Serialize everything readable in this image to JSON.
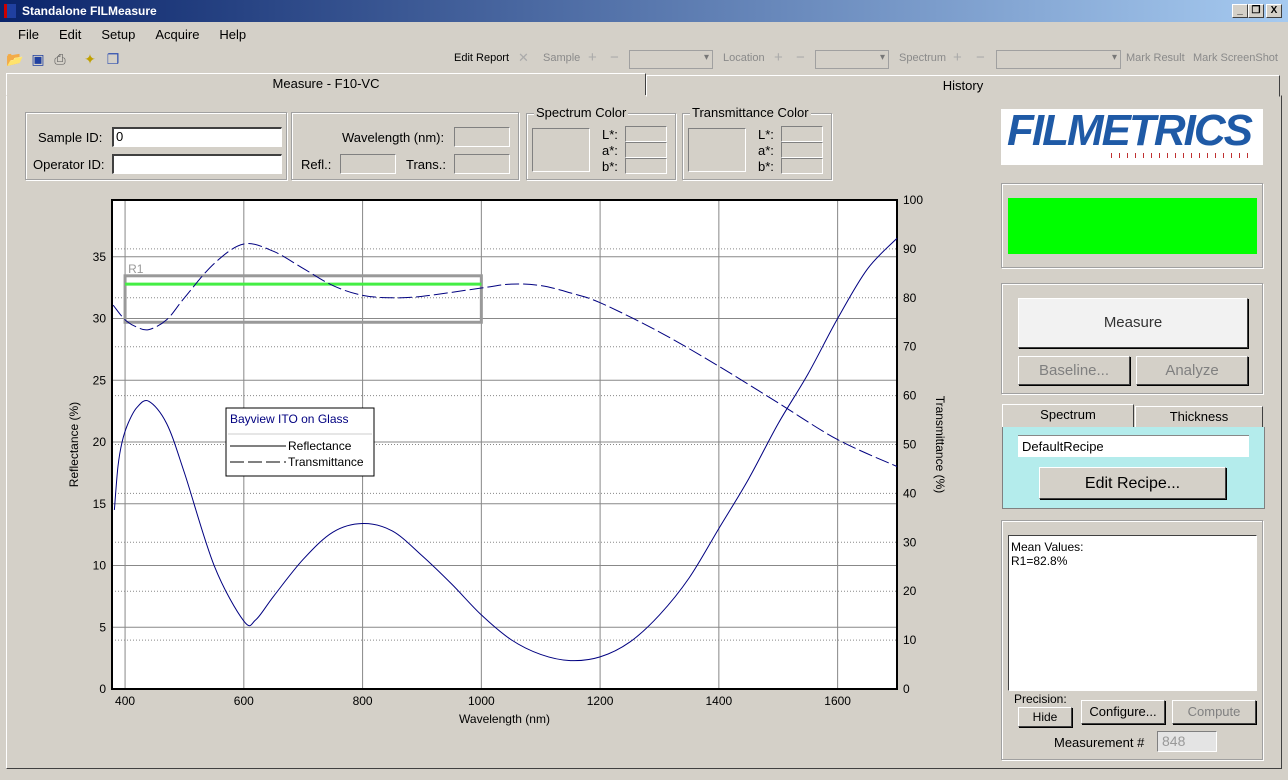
{
  "window": {
    "title": "Standalone FILMeasure",
    "minimize": "_",
    "restore": "❐",
    "close": "X"
  },
  "menu": [
    "File",
    "Edit",
    "Setup",
    "Acquire",
    "Help"
  ],
  "toolbar": {
    "icons": [
      "open-folder-icon",
      "save-icon",
      "print-icon",
      "new-report-icon",
      "copy-icon"
    ],
    "edit_report": "Edit Report",
    "sample": "Sample",
    "location": "Location",
    "spectrum": "Spectrum",
    "mark_result": "Mark Result",
    "mark_screenshot": "Mark ScreenShot",
    "plus": "+",
    "minus": "−",
    "x": "✕"
  },
  "tabs": [
    {
      "label": "Measure - F10-VC",
      "active": true
    },
    {
      "label": "History",
      "active": false
    }
  ],
  "ids": {
    "sample_label": "Sample ID:",
    "sample_value": "0",
    "operator_label": "Operator ID:",
    "operator_value": ""
  },
  "readout": {
    "wavelength_label": "Wavelength (nm):",
    "refl_label": "Refl.:",
    "trans_label": "Trans.:"
  },
  "spectrum_color": {
    "title": "Spectrum Color",
    "L": "L*:",
    "a": "a*:",
    "b": "b*:"
  },
  "transmittance_color": {
    "title": "Transmittance Color",
    "L": "L*:",
    "a": "a*:",
    "b": "b*:"
  },
  "logo": "FILMETRICS",
  "status_color": "#00ff00",
  "buttons": {
    "measure": "Measure",
    "baseline": "Baseline...",
    "analyze": "Analyze",
    "edit_recipe": "Edit Recipe...",
    "hide": "Hide",
    "configure": "Configure...",
    "compute": "Compute"
  },
  "recipe_tabs": [
    "Spectrum",
    "Thickness"
  ],
  "recipe": "DefaultRecipe",
  "results": {
    "line1": "Mean Values:",
    "line2": "R1=82.8%"
  },
  "precision_label": "Precision:",
  "measurement_label": "Measurement #",
  "measurement_value": "848",
  "chart_data": {
    "type": "line",
    "legend_title": "Bayview ITO on Glass",
    "legend_placement": "center-left",
    "xlabel": "Wavelength (nm)",
    "ylabel": "Reflectance (%)",
    "y2label": "Transmittance (%)",
    "xlim": [
      378,
      1700
    ],
    "ylim": [
      0,
      39.6
    ],
    "y2lim": [
      0,
      100
    ],
    "xticks": [
      400,
      600,
      800,
      1000,
      1200,
      1400,
      1600
    ],
    "yticks": [
      0,
      5,
      10,
      15,
      20,
      25,
      30,
      35
    ],
    "y2ticks": [
      0,
      10,
      20,
      30,
      40,
      50,
      60,
      70,
      80,
      90,
      100
    ],
    "grid": true,
    "line_color": "#000080",
    "series": [
      {
        "name": "Reflectance",
        "axis": "left",
        "style": "solid",
        "x": [
          382,
          388,
          395,
          405,
          420,
          440,
          470,
          500,
          550,
          600,
          620,
          650,
          700,
          750,
          800,
          850,
          900,
          950,
          1000,
          1050,
          1100,
          1150,
          1200,
          1250,
          1300,
          1350,
          1400,
          1450,
          1500,
          1550,
          1600,
          1650,
          1700
        ],
        "y": [
          14.5,
          18,
          20,
          21.5,
          22.8,
          23.3,
          21.5,
          17.5,
          10,
          5.5,
          5.6,
          7.5,
          10.5,
          12.7,
          13.4,
          12.8,
          10.8,
          8.5,
          6,
          4,
          2.8,
          2.3,
          2.6,
          3.8,
          6,
          9,
          13,
          17,
          21.5,
          25.5,
          30,
          34,
          36.5
        ]
      },
      {
        "name": "Transmittance",
        "axis": "right",
        "style": "dashed",
        "x": [
          380,
          400,
          420,
          440,
          470,
          500,
          550,
          600,
          650,
          700,
          750,
          800,
          850,
          900,
          1000,
          1050,
          1100,
          1150,
          1200,
          1300,
          1400,
          1500,
          1600,
          1700
        ],
        "y": [
          78.5,
          75.5,
          74,
          73.5,
          75.5,
          80,
          87,
          91,
          89.5,
          86,
          82.5,
          80.5,
          80,
          80.3,
          82,
          82.8,
          82.5,
          81,
          79,
          73,
          66,
          58.5,
          51,
          45.5
        ]
      }
    ],
    "region": {
      "label": "R1",
      "x": [
        400,
        1000
      ],
      "y2": [
        75,
        84.5
      ],
      "mean": 82.8,
      "mean_color": "#44ee44"
    }
  }
}
